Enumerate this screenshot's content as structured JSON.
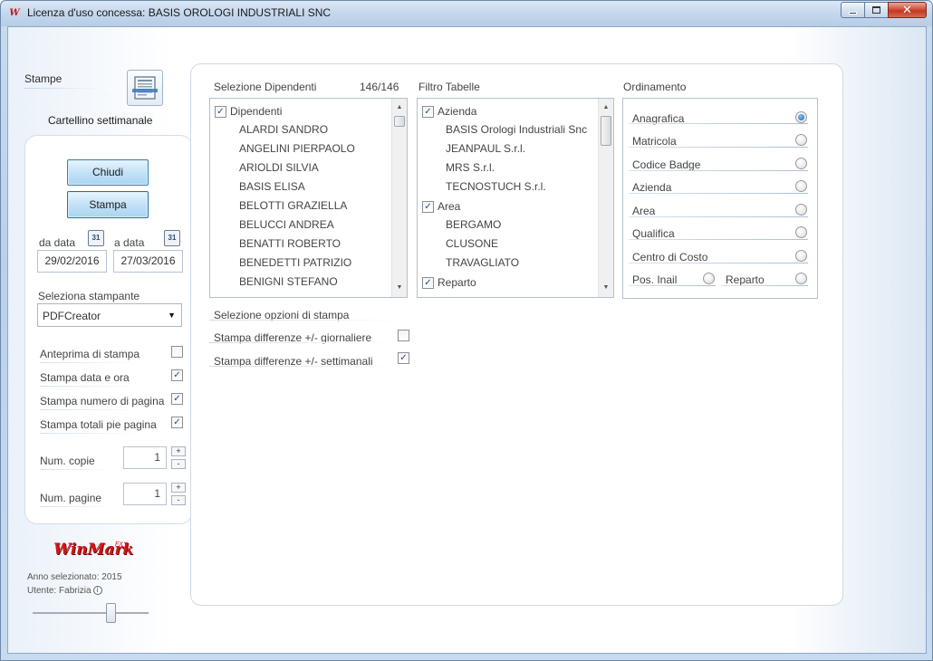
{
  "window": {
    "title": "Licenza d'uso concessa: BASIS OROLOGI INDUSTRIALI SNC",
    "icon_text": "W",
    "minimize_glyph": "",
    "close_glyph": "✕"
  },
  "left": {
    "stampe_label": "Stampe",
    "report_name": "Cartellino settimanale",
    "chiudi_label": "Chiudi",
    "stampa_label": "Stampa",
    "da_data_label": "da data",
    "a_data_label": "a data",
    "da_data_value": "29/02/2016",
    "a_data_value": "27/03/2016",
    "calendar_text": "31",
    "printer_label": "Seleziona stampante",
    "printer_value": "PDFCreator",
    "options": [
      {
        "label": "Anteprima di stampa",
        "checked": false
      },
      {
        "label": "Stampa data e ora",
        "checked": true
      },
      {
        "label": "Stampa numero di pagina",
        "checked": true
      },
      {
        "label": "Stampa totali pie pagina",
        "checked": true
      }
    ],
    "num_copie_label": "Num. copie",
    "num_copie_value": "1",
    "num_pagine_label": "Num. pagine",
    "num_pagine_value": "1",
    "plus": "+",
    "minus": "-"
  },
  "footer": {
    "logo_text": "WinMark",
    "logo_sup": "FX",
    "anno": "Anno selezionato: 2015",
    "utente": "Utente: Fabrizia",
    "info_glyph": "i",
    "slider_value": 0.68
  },
  "dipendenti": {
    "title": "Selezione Dipendenti",
    "count": "146/146",
    "header": "Dipendenti",
    "header_checked": true,
    "items": [
      "ALARDI SANDRO",
      "ANGELINI PIERPAOLO",
      "ARIOLDI SILVIA",
      "BASIS ELISA",
      "BELOTTI GRAZIELLA",
      "BELUCCI ANDREA",
      "BENATTI ROBERTO",
      "BENEDETTI PATRIZIO",
      "BENIGNI STEFANO"
    ]
  },
  "filtro": {
    "title": "Filtro Tabelle",
    "groups": [
      {
        "label": "Azienda",
        "checked": true,
        "items": [
          "BASIS Orologi Industriali Snc",
          "JEANPAUL S.r.l.",
          "MRS S.r.l.",
          "TECNOSTUCH S.r.l."
        ]
      },
      {
        "label": "Area",
        "checked": true,
        "items": [
          "BERGAMO",
          "CLUSONE",
          "TRAVAGLIATO"
        ]
      },
      {
        "label": "Reparto",
        "checked": true,
        "items": []
      }
    ]
  },
  "ordinamento": {
    "title": "Ordinamento",
    "items": [
      {
        "label": "Anagrafica",
        "selected": true
      },
      {
        "label": "Matricola",
        "selected": false
      },
      {
        "label": "Codice Badge",
        "selected": false
      },
      {
        "label": "Azienda",
        "selected": false
      },
      {
        "label": "Area",
        "selected": false
      },
      {
        "label": "Qualifica",
        "selected": false
      },
      {
        "label": "Centro di Costo",
        "selected": false
      }
    ],
    "split_left": {
      "label": "Pos. Inail",
      "selected": false
    },
    "split_right": {
      "label": "Reparto",
      "selected": false
    }
  },
  "opzioni": {
    "title": "Selezione opzioni di stampa",
    "items": [
      {
        "label": "Stampa differenze +/- giornaliere",
        "checked": false
      },
      {
        "label": "Stampa differenze +/- settimanali",
        "checked": true
      }
    ]
  },
  "glyphs": {
    "check": "✓",
    "up": "▲",
    "down": "▼",
    "dropdown": "▼"
  }
}
